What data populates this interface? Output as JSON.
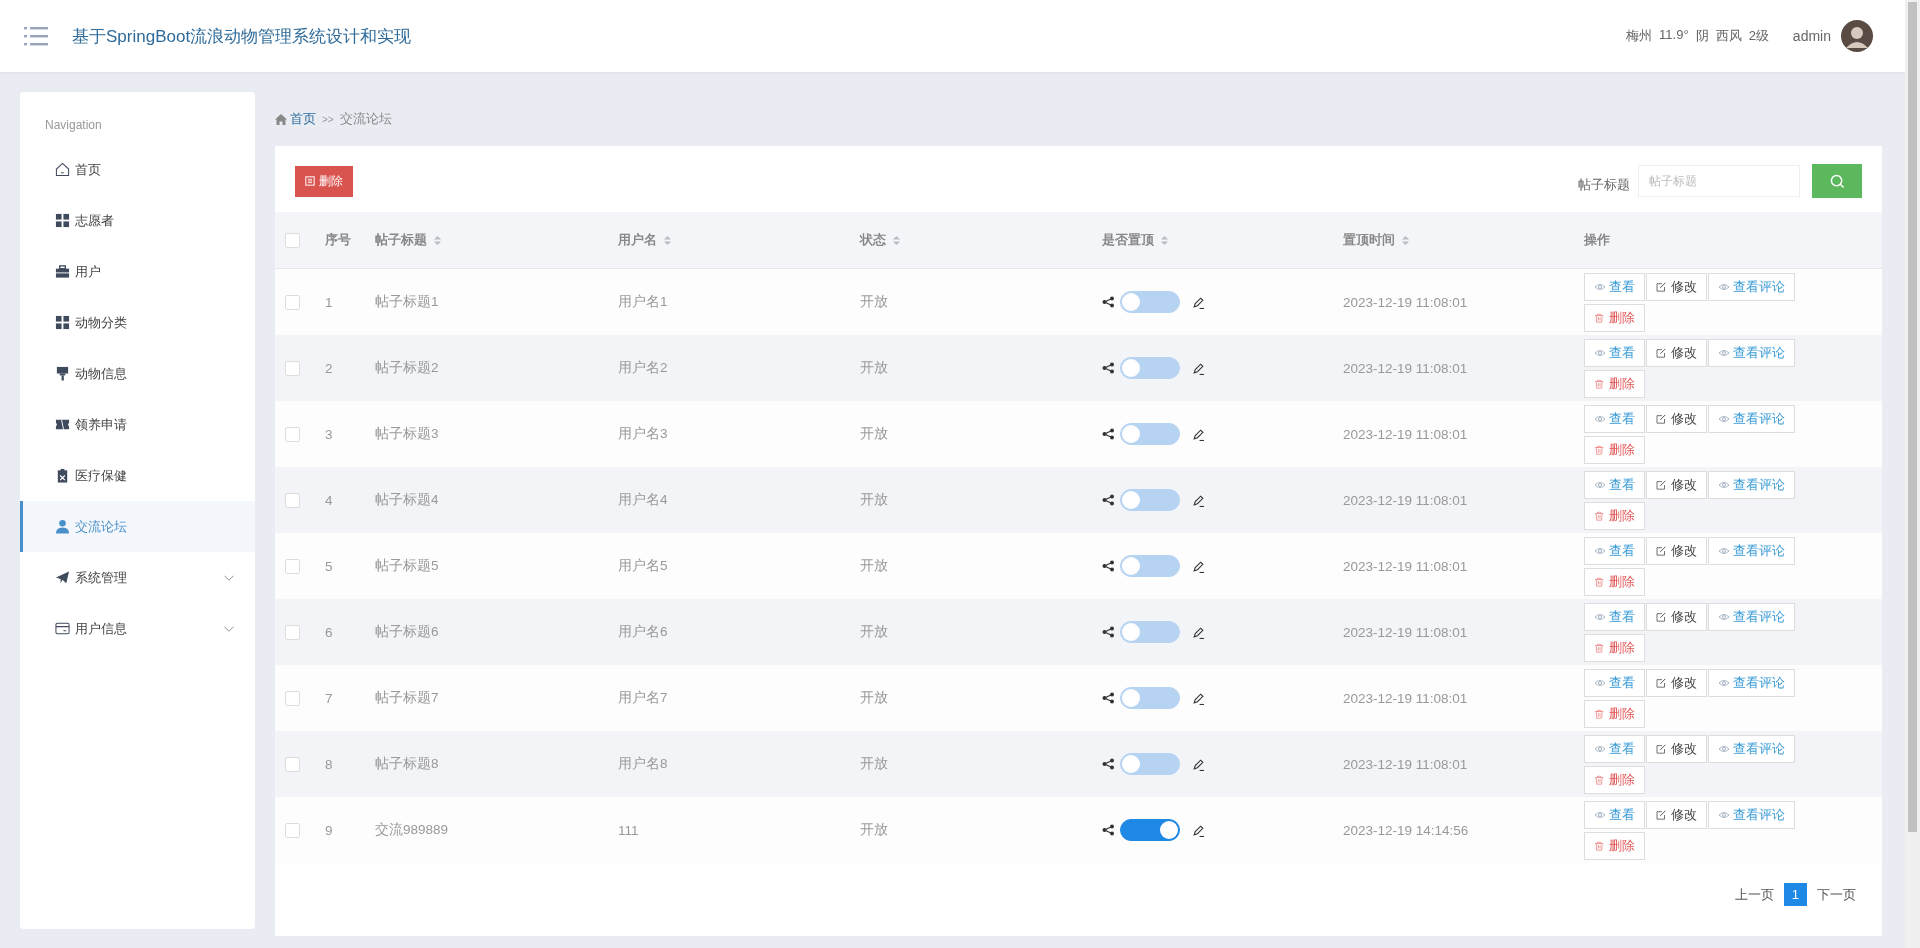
{
  "header": {
    "title": "基于SpringBoot流浪动物管理系统设计和实现",
    "weather": [
      "梅州",
      "11.9°",
      "阴",
      "西风",
      "2级"
    ],
    "user": "admin"
  },
  "sidebar": {
    "heading": "Navigation",
    "items": [
      {
        "label": "首页",
        "selected": false
      },
      {
        "label": "志愿者",
        "selected": false
      },
      {
        "label": "用户",
        "selected": false
      },
      {
        "label": "动物分类",
        "selected": false
      },
      {
        "label": "动物信息",
        "selected": false
      },
      {
        "label": "领养申请",
        "selected": false
      },
      {
        "label": "医疗保健",
        "selected": false
      },
      {
        "label": "交流论坛",
        "selected": true
      },
      {
        "label": "系统管理",
        "selected": false,
        "expanded": false
      },
      {
        "label": "用户信息",
        "selected": false,
        "expanded": false
      }
    ]
  },
  "breadcrumb": {
    "home": "首页",
    "separator": ">>",
    "current": "交流论坛"
  },
  "toolbar": {
    "delete_button": "删除",
    "search_label": "帖子标题",
    "search_placeholder": "帖子标题"
  },
  "table": {
    "select_all_checked": false,
    "columns": [
      "序号",
      "帖子标题",
      "用户名",
      "状态",
      "是否置顶",
      "置顶时间",
      "操作"
    ],
    "rows": [
      {
        "index": "1",
        "title": "帖子标题1",
        "user": "用户名1",
        "status": "开放",
        "pinned": false,
        "time": "2023-12-19 11:08:01",
        "checked": false,
        "actions": [
          "查看",
          "修改",
          "查看评论",
          "删除"
        ]
      },
      {
        "index": "2",
        "title": "帖子标题2",
        "user": "用户名2",
        "status": "开放",
        "pinned": false,
        "time": "2023-12-19 11:08:01",
        "checked": false,
        "actions": [
          "查看",
          "修改",
          "查看评论",
          "删除"
        ]
      },
      {
        "index": "3",
        "title": "帖子标题3",
        "user": "用户名3",
        "status": "开放",
        "pinned": false,
        "time": "2023-12-19 11:08:01",
        "checked": false,
        "actions": [
          "查看",
          "修改",
          "查看评论",
          "删除"
        ]
      },
      {
        "index": "4",
        "title": "帖子标题4",
        "user": "用户名4",
        "status": "开放",
        "pinned": false,
        "time": "2023-12-19 11:08:01",
        "checked": false,
        "actions": [
          "查看",
          "修改",
          "查看评论",
          "删除"
        ]
      },
      {
        "index": "5",
        "title": "帖子标题5",
        "user": "用户名5",
        "status": "开放",
        "pinned": false,
        "time": "2023-12-19 11:08:01",
        "checked": false,
        "actions": [
          "查看",
          "修改",
          "查看评论",
          "删除"
        ]
      },
      {
        "index": "6",
        "title": "帖子标题6",
        "user": "用户名6",
        "status": "开放",
        "pinned": false,
        "time": "2023-12-19 11:08:01",
        "checked": false,
        "actions": [
          "查看",
          "修改",
          "查看评论",
          "删除"
        ]
      },
      {
        "index": "7",
        "title": "帖子标题7",
        "user": "用户名7",
        "status": "开放",
        "pinned": false,
        "time": "2023-12-19 11:08:01",
        "checked": false,
        "actions": [
          "查看",
          "修改",
          "查看评论",
          "删除"
        ]
      },
      {
        "index": "8",
        "title": "帖子标题8",
        "user": "用户名8",
        "status": "开放",
        "pinned": false,
        "time": "2023-12-19 11:08:01",
        "checked": false,
        "actions": [
          "查看",
          "修改",
          "查看评论",
          "删除"
        ]
      },
      {
        "index": "9",
        "title": "交流989889",
        "user": "111",
        "status": "开放",
        "pinned": true,
        "time": "2023-12-19 14:14:56",
        "checked": false,
        "actions": [
          "查看",
          "修改",
          "查看评论",
          "删除"
        ]
      }
    ]
  },
  "pagination": {
    "prev": "上一页",
    "pages": [
      {
        "label": "1",
        "selected": true
      }
    ],
    "next": "下一页"
  }
}
